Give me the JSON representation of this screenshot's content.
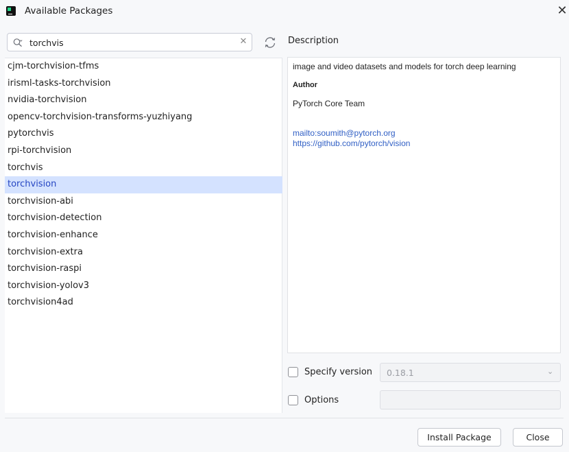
{
  "window": {
    "title": "Available Packages",
    "close_glyph": "✕",
    "app_icon": "pycharm-icon"
  },
  "search": {
    "value": "torchvis",
    "clear_glyph": "✕",
    "icons": {
      "search": "search-icon",
      "clear": "clear-icon",
      "refresh": "refresh-icon"
    }
  },
  "packages": [
    "cjm-torchvision-tfms",
    "irisml-tasks-torchvision",
    "nvidia-torchvision",
    "opencv-torchvision-transforms-yuzhiyang",
    "pytorchvis",
    "rpi-torchvision",
    "torchvis",
    "torchvision",
    "torchvision-abi",
    "torchvision-detection",
    "torchvision-enhance",
    "torchvision-extra",
    "torchvision-raspi",
    "torchvision-yolov3",
    "torchvision4ad"
  ],
  "selected_package": "torchvision",
  "description": {
    "header": "Description",
    "summary": "image and video datasets and models for torch deep learning",
    "author_label": "Author",
    "author": "PyTorch Core Team",
    "email_link": "mailto:soumith@pytorch.org",
    "homepage_link": "https://github.com/pytorch/vision"
  },
  "options": {
    "specify_version_label": "Specify version",
    "specify_version_checked": false,
    "version_value": "0.18.1",
    "options_label": "Options",
    "options_checked": false,
    "options_value": ""
  },
  "buttons": {
    "install": "Install Package",
    "close": "Close"
  },
  "colors": {
    "selection_bg": "#d4e2ff",
    "selection_text": "#2545c2",
    "link": "#2f5ec4"
  }
}
